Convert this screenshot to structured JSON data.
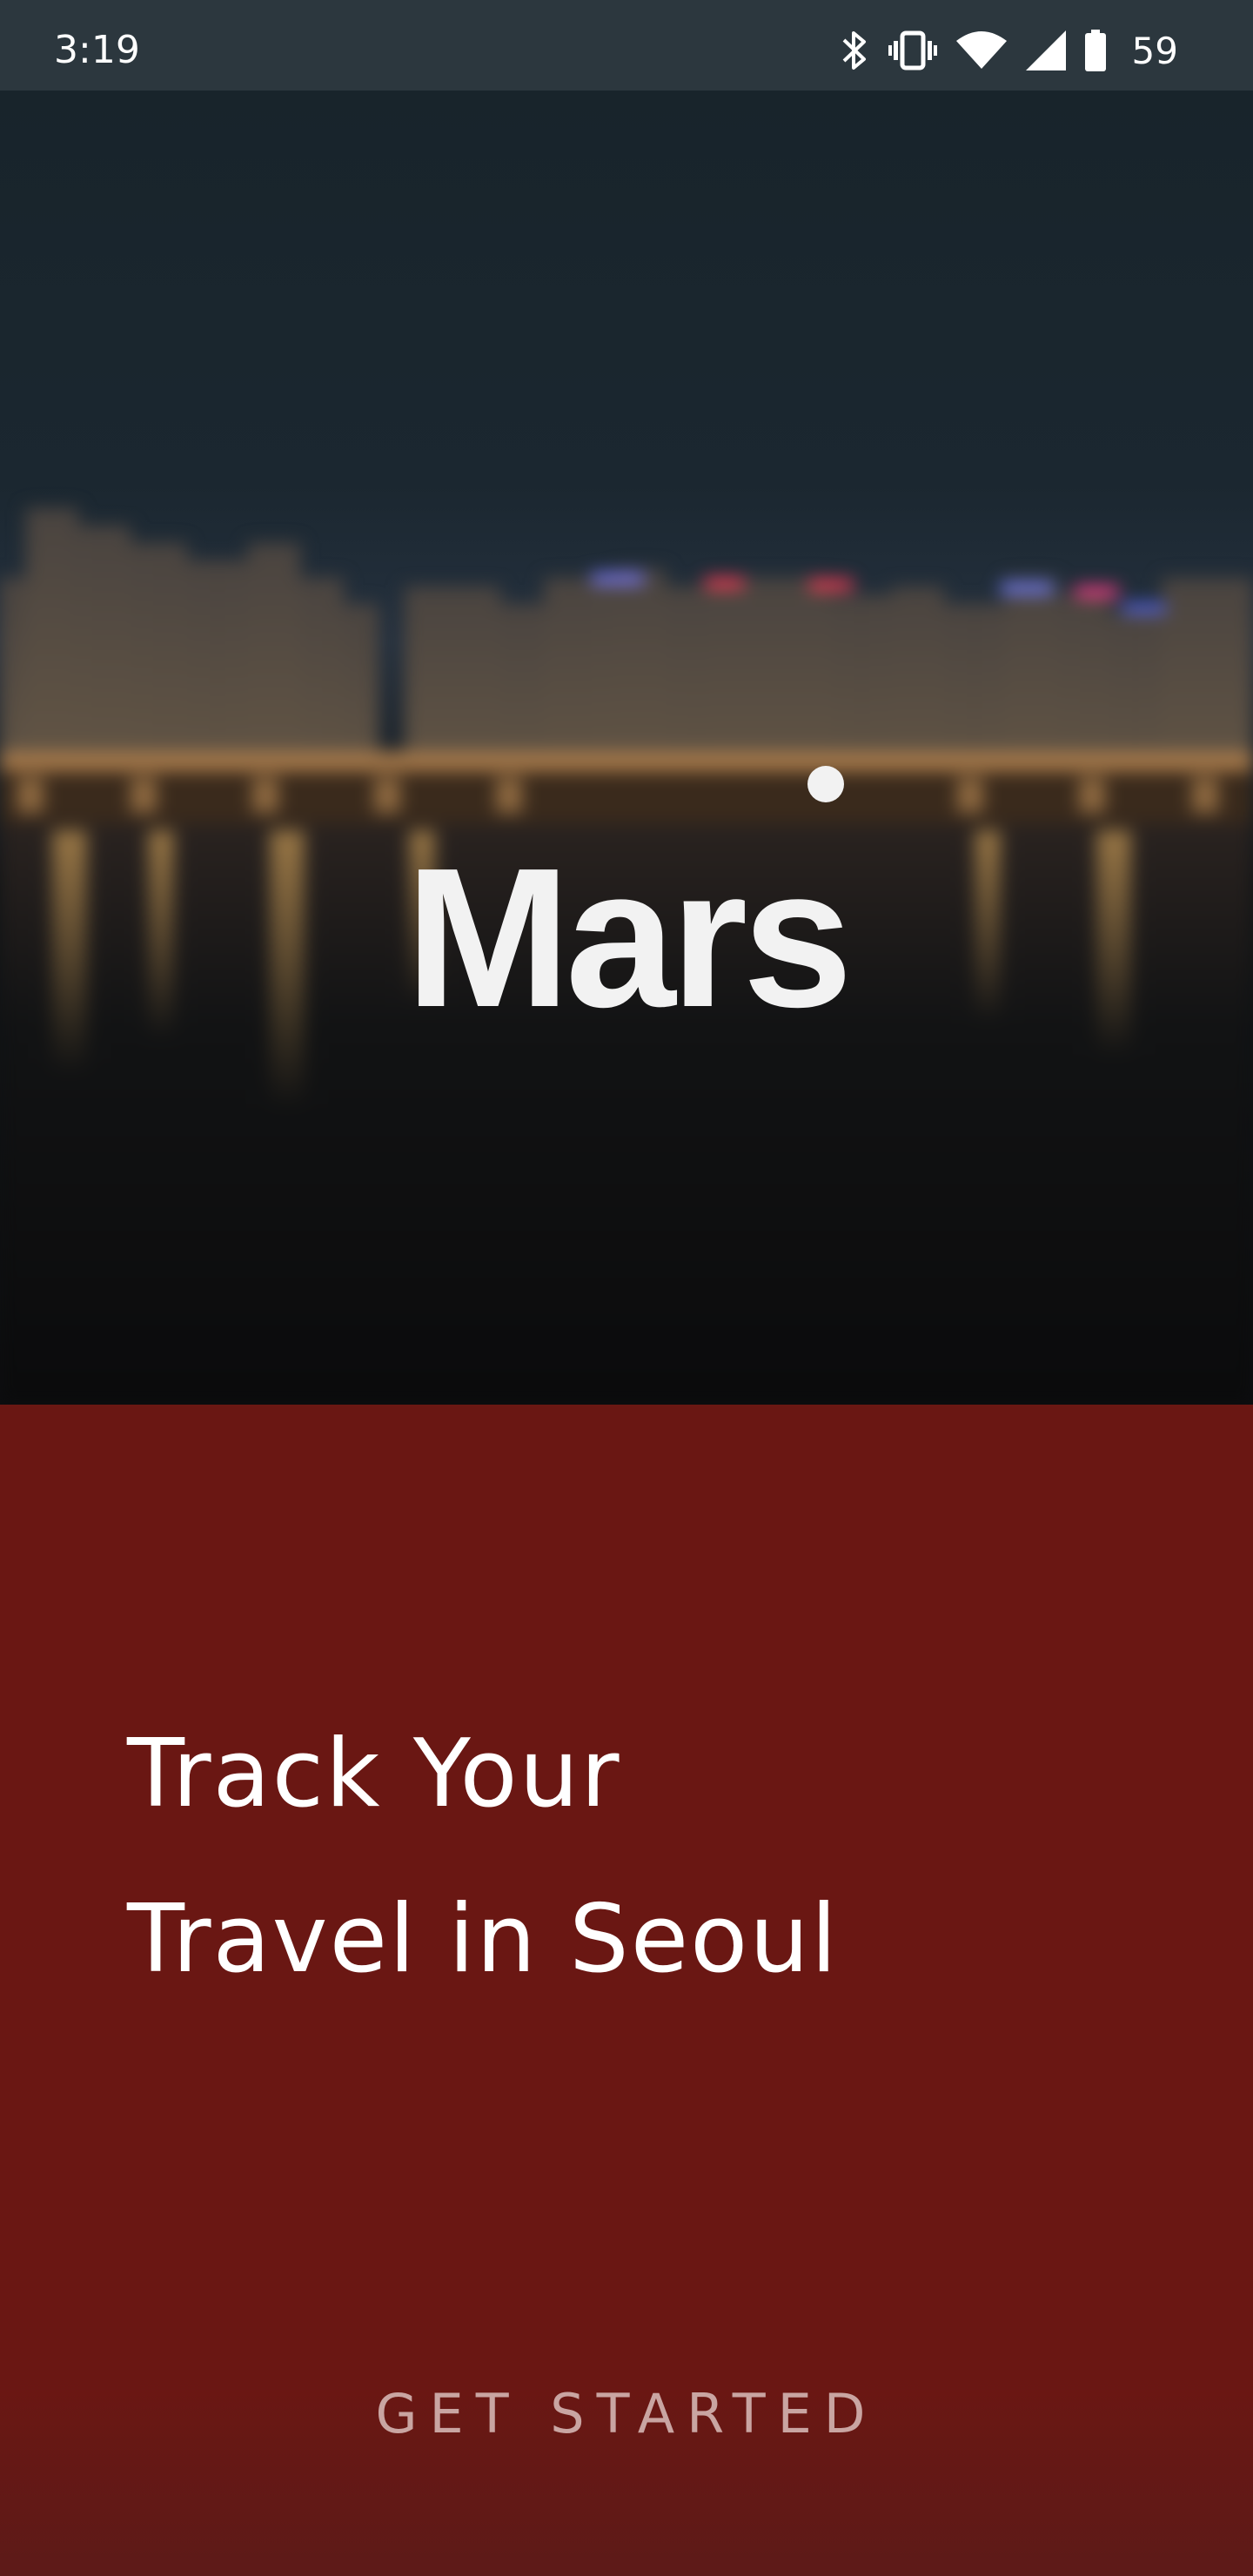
{
  "status_bar": {
    "time": "3:19",
    "battery_level": "59",
    "icons": [
      "bluetooth-icon",
      "vibrate-icon",
      "wifi-icon",
      "cell-signal-icon",
      "battery-icon"
    ]
  },
  "hero": {
    "logo_text": "Mars"
  },
  "main": {
    "tagline_line1": "Track Your",
    "tagline_line2": "Travel in Seoul",
    "cta_label": "GET STARTED"
  },
  "colors": {
    "panel_background": "#6a1713",
    "status_bar_background": "#2c373e",
    "cta_text": "#c9a5a2"
  }
}
